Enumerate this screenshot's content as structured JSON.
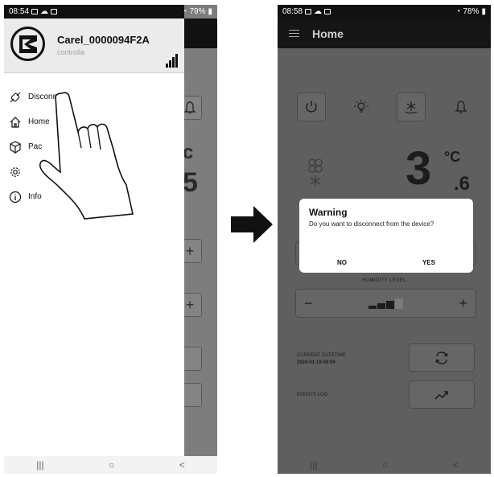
{
  "left_screen": {
    "status": {
      "time": "08:54",
      "battery": "79%"
    },
    "drawer": {
      "device_name": "Carel_0000094F2A",
      "device_sub": "controlla",
      "menu": [
        {
          "label": "Disconnect",
          "icon": "disconnect-icon"
        },
        {
          "label": "Home",
          "icon": "home-icon"
        },
        {
          "label": "Pac",
          "icon": "package-icon"
        },
        {
          "label": "",
          "icon": "gear-icon"
        },
        {
          "label": "Info",
          "icon": "info-icon"
        }
      ]
    },
    "background": {
      "digit_top": "c",
      "digit_bottom": "5",
      "plus": "+"
    },
    "nav": {
      "recent": "|||",
      "home": "○",
      "back": "<"
    }
  },
  "right_screen": {
    "status": {
      "time": "08:58",
      "battery": "78%"
    },
    "header_title": "Home",
    "temperature": {
      "integer": "3",
      "decimal": ".6",
      "unit": "°C"
    },
    "humidity_label": "HUMIDITY LEVEL",
    "humidity": {
      "minus": "−",
      "plus": "+",
      "level": 3,
      "max": 4
    },
    "current_datetime_label": "CURRENT DATETIME",
    "current_datetime_value": "2024-01-19 08:59",
    "events_log_label": "EVENTS LOG",
    "dialog": {
      "title": "Warning",
      "message": "Do you want to disconnect from the device?",
      "no": "NO",
      "yes": "YES"
    },
    "nav": {
      "recent": "|||",
      "home": "○",
      "back": "<"
    }
  },
  "colors": {
    "dark": "#111111",
    "overlay": "#5f5f5f",
    "drawer_head": "#ebebeb"
  }
}
